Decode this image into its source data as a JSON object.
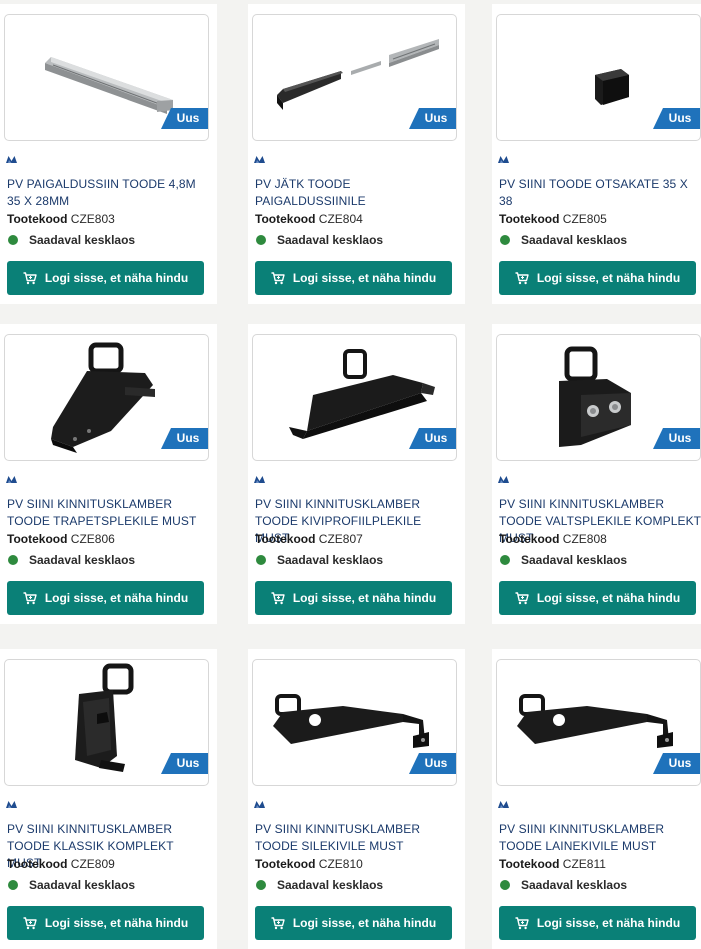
{
  "badge_label": "Uus",
  "code_label": "Tootekood",
  "stock_label": "Saadaval kesklaos",
  "button_label": "Logi sisse, et näha hindu",
  "colors": {
    "accent": "#0a8077",
    "badge": "#1f72bb",
    "title": "#1b3a6b",
    "stock": "#2e8a3e"
  },
  "products": [
    {
      "title": "PV PAIGALDUSSIIN TOODE 4,8m 35 x 28mm",
      "code": "CZE803",
      "image": "rail-profile"
    },
    {
      "title": "PV JÄTK TOODE PAIGALDUSSIINILE",
      "code": "CZE804",
      "image": "rail-joint"
    },
    {
      "title": "PV SIINI TOODE OTSAKATE 35 x 38",
      "code": "CZE805",
      "image": "end-cap"
    },
    {
      "title": "PV SIINI KINNITUSKLAMBER TOODE TRAPETSPLEKILE MUST",
      "code": "CZE806",
      "image": "bracket-trapezoid"
    },
    {
      "title": "PV SIINI KINNITUSKLAMBER TOODE KIVIPROFIILPLEKILE MUST",
      "code": "CZE807",
      "image": "bracket-stone-profile"
    },
    {
      "title": "PV SIINI KINNITUSKLAMBER TOODE VALTSPLEKILE KOMPLEKT MUST",
      "code": "CZE808",
      "image": "bracket-seam"
    },
    {
      "title": "PV SIINI KINNITUSKLAMBER TOODE KLASSIK KOMPLEKT MUST",
      "code": "CZE809",
      "image": "bracket-classic"
    },
    {
      "title": "PV SIINI KINNITUSKLAMBER TOODE SILEKIVILE MUST",
      "code": "CZE810",
      "image": "bracket-hook"
    },
    {
      "title": "PV SIINI KINNITUSKLAMBER TOODE LAINEKIVILE MUST",
      "code": "CZE811",
      "image": "bracket-hook"
    }
  ]
}
